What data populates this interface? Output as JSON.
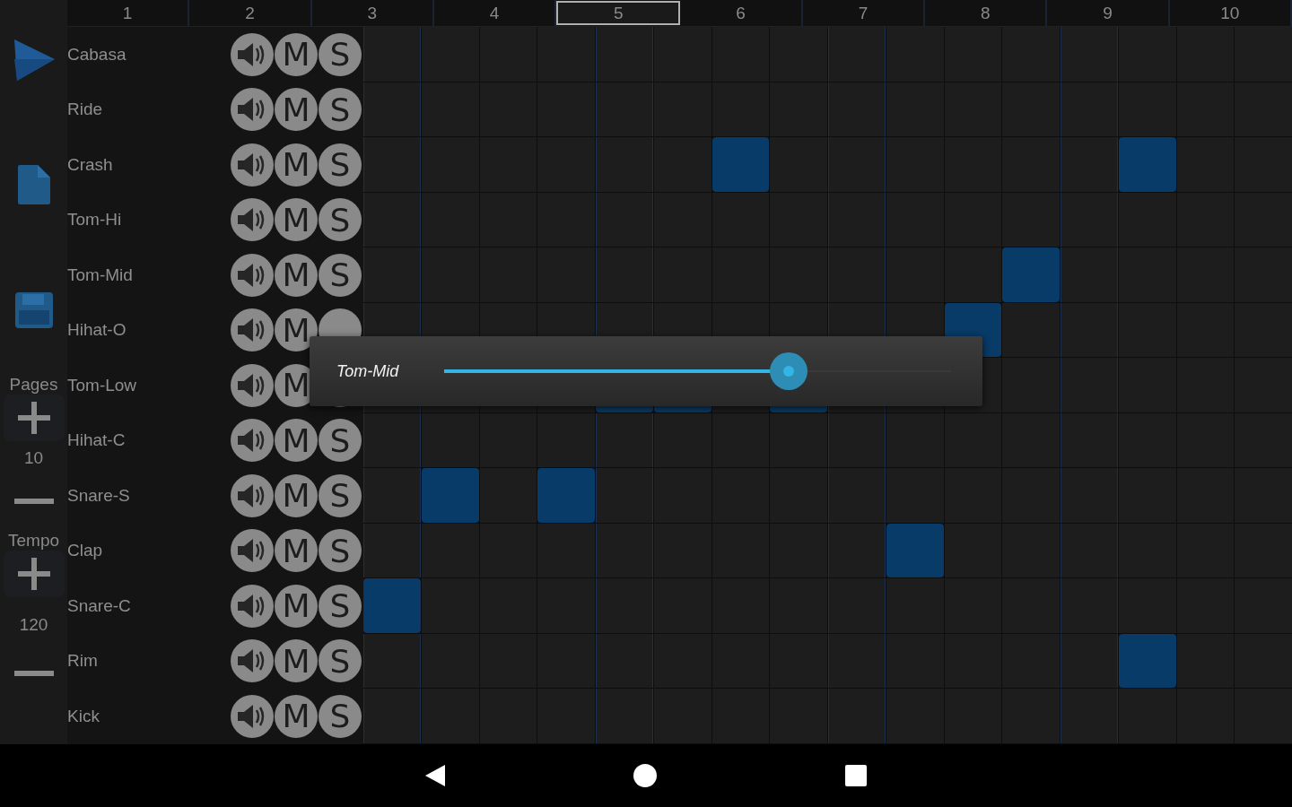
{
  "page_numbers": [
    {
      "label": "1",
      "selected": false
    },
    {
      "label": "2",
      "selected": false
    },
    {
      "label": "3",
      "selected": false
    },
    {
      "label": "4",
      "selected": false
    },
    {
      "label": "5",
      "selected": true
    },
    {
      "label": "6",
      "selected": false
    },
    {
      "label": "7",
      "selected": false
    },
    {
      "label": "8",
      "selected": false
    },
    {
      "label": "9",
      "selected": false
    },
    {
      "label": "10",
      "selected": false
    }
  ],
  "pages": {
    "label": "Pages",
    "value": "10"
  },
  "tempo": {
    "label": "Tempo",
    "value": "120"
  },
  "tracks": [
    {
      "name": "Cabasa",
      "mute": "M",
      "solo": "S",
      "steps": [
        false,
        false,
        false,
        false,
        false,
        false,
        false,
        false,
        false,
        false,
        false,
        false,
        false,
        false,
        false,
        false
      ]
    },
    {
      "name": "Ride",
      "mute": "M",
      "solo": "S",
      "steps": [
        false,
        false,
        false,
        false,
        false,
        false,
        false,
        false,
        false,
        false,
        false,
        false,
        false,
        false,
        false,
        false
      ]
    },
    {
      "name": "Crash",
      "mute": "M",
      "solo": "S",
      "steps": [
        false,
        false,
        false,
        false,
        false,
        false,
        true,
        false,
        false,
        false,
        false,
        false,
        false,
        true,
        false,
        false
      ]
    },
    {
      "name": "Tom-Hi",
      "mute": "M",
      "solo": "S",
      "steps": [
        false,
        false,
        false,
        false,
        false,
        false,
        false,
        false,
        false,
        false,
        false,
        false,
        false,
        false,
        false,
        false
      ]
    },
    {
      "name": "Tom-Mid",
      "mute": "M",
      "solo": "S",
      "steps": [
        false,
        false,
        false,
        false,
        false,
        false,
        false,
        false,
        false,
        false,
        false,
        true,
        false,
        false,
        false,
        false
      ]
    },
    {
      "name": "Hihat-O",
      "mute": "M",
      "steps": [
        false,
        false,
        false,
        false,
        false,
        false,
        false,
        false,
        false,
        false,
        true,
        false,
        false,
        false,
        false,
        false
      ]
    },
    {
      "name": "Tom-Low",
      "mute": "M",
      "steps": [
        false,
        false,
        false,
        false,
        true,
        true,
        false,
        true,
        false,
        false,
        false,
        false,
        false,
        false,
        false,
        false
      ]
    },
    {
      "name": "Hihat-C",
      "mute": "M",
      "solo": "S",
      "steps": [
        false,
        false,
        false,
        false,
        false,
        false,
        false,
        false,
        false,
        false,
        false,
        false,
        false,
        false,
        false,
        false
      ]
    },
    {
      "name": "Snare-S",
      "mute": "M",
      "solo": "S",
      "steps": [
        false,
        true,
        false,
        true,
        false,
        false,
        false,
        false,
        false,
        false,
        false,
        false,
        false,
        false,
        false,
        false
      ]
    },
    {
      "name": "Clap",
      "mute": "M",
      "solo": "S",
      "steps": [
        false,
        false,
        false,
        false,
        false,
        false,
        false,
        false,
        false,
        true,
        false,
        false,
        false,
        false,
        false,
        false
      ]
    },
    {
      "name": "Snare-C",
      "mute": "M",
      "solo": "S",
      "steps": [
        true,
        false,
        false,
        false,
        false,
        false,
        false,
        false,
        false,
        false,
        false,
        false,
        false,
        false,
        false,
        false
      ]
    },
    {
      "name": "Rim",
      "mute": "M",
      "solo": "S",
      "steps": [
        false,
        false,
        false,
        false,
        false,
        false,
        false,
        false,
        false,
        false,
        false,
        false,
        false,
        true,
        false,
        false
      ]
    },
    {
      "name": "Kick",
      "mute": "M",
      "solo": "S",
      "steps": [
        false,
        false,
        false,
        false,
        false,
        false,
        false,
        false,
        false,
        false,
        false,
        false,
        false,
        false,
        false,
        false
      ]
    }
  ],
  "volume_popup": {
    "track": "Tom-Mid",
    "level": 0.68
  }
}
